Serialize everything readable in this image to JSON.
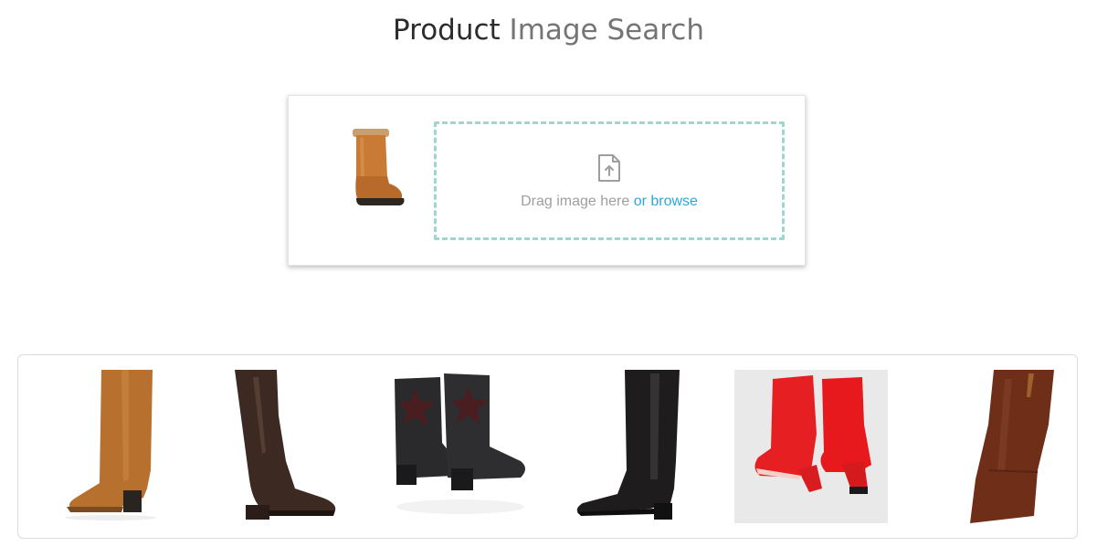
{
  "header": {
    "title_part1": "Product",
    "title_part2": "Image Search"
  },
  "upload": {
    "preview_icon": "brown-boot-image",
    "upload_icon": "file-upload-icon",
    "drag_text": "Drag image here",
    "browse_text": "or browse"
  },
  "results": [
    {
      "icon": "tan-knee-boot-image",
      "bg": "#ffffff"
    },
    {
      "icon": "dark-brown-knee-boot-image",
      "bg": "#ffffff"
    },
    {
      "icon": "black-star-chelsea-boots-image",
      "bg": "#ffffff"
    },
    {
      "icon": "black-riding-boot-image",
      "bg": "#ffffff"
    },
    {
      "icon": "red-ankle-boots-image",
      "bg": "#e9e9e9"
    },
    {
      "icon": "brown-riding-boot-image",
      "bg": "#ffffff"
    }
  ],
  "colors": {
    "accent_link": "#29a8e0",
    "dropzone_border": "#9fd6d1"
  }
}
